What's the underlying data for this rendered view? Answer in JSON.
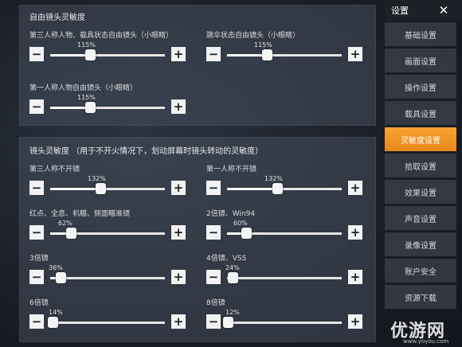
{
  "free_camera": {
    "title": "自由镜头灵敏度",
    "settings": [
      {
        "label": "第三人称人物、载具状态自由镜头（小眼睛）",
        "value_text": "115%",
        "value": 0.35
      },
      {
        "label": "跳伞状态自由镜头（小眼睛）",
        "value_text": "115%",
        "value": 0.35
      },
      {
        "label": "第一人称人物自由镜头（小眼睛）",
        "value_text": "115%",
        "value": 0.35
      }
    ]
  },
  "camera": {
    "title": "镜头灵敏度   （用于不开火情况下，划动屏幕时镜头转动的灵敏度）",
    "settings": [
      {
        "label": "第三人称不开镜",
        "value_text": "132%",
        "value": 0.44
      },
      {
        "label": "第一人称不开镜",
        "value_text": "132%",
        "value": 0.44
      },
      {
        "label": "红点、全息、机瞄、侧面瞄准镜",
        "value_text": "62%",
        "value": 0.18
      },
      {
        "label": "2倍镜、Win94",
        "value_text": "60%",
        "value": 0.17
      },
      {
        "label": "3倍镜",
        "value_text": "36%",
        "value": 0.09
      },
      {
        "label": "4倍镜、VSS",
        "value_text": "24%",
        "value": 0.05
      },
      {
        "label": "6倍镜",
        "value_text": "14%",
        "value": 0.02
      },
      {
        "label": "8倍镜",
        "value_text": "12%",
        "value": 0.01
      }
    ]
  },
  "controls": {
    "minus": "−",
    "plus": "+"
  },
  "menu": {
    "title": "设置",
    "close": "✕",
    "active_index": 4,
    "items": [
      "基础设置",
      "画面设置",
      "操作设置",
      "载具设置",
      "灵敏度设置",
      "拾取设置",
      "效果设置",
      "声音设置",
      "录像设置",
      "账户安全",
      "资源下载"
    ]
  },
  "watermark": {
    "main": "优游网",
    "sub": "www.yoyou.com"
  }
}
